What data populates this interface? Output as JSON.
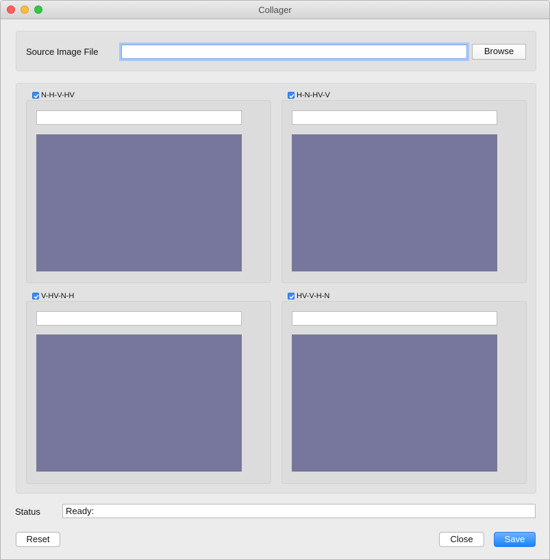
{
  "window": {
    "title": "Collager"
  },
  "source": {
    "label": "Source Image File",
    "value": "",
    "browse_label": "Browse"
  },
  "panels": [
    {
      "label": "N-H-V-HV",
      "checked": true,
      "value": ""
    },
    {
      "label": "H-N-HV-V",
      "checked": true,
      "value": ""
    },
    {
      "label": "V-HV-N-H",
      "checked": true,
      "value": ""
    },
    {
      "label": "HV-V-H-N",
      "checked": true,
      "value": ""
    }
  ],
  "status": {
    "label": "Status",
    "value": "Ready:"
  },
  "buttons": {
    "reset": "Reset",
    "close": "Close",
    "save": "Save"
  },
  "colors": {
    "preview": "#77779d",
    "accent": "#1984f8"
  }
}
